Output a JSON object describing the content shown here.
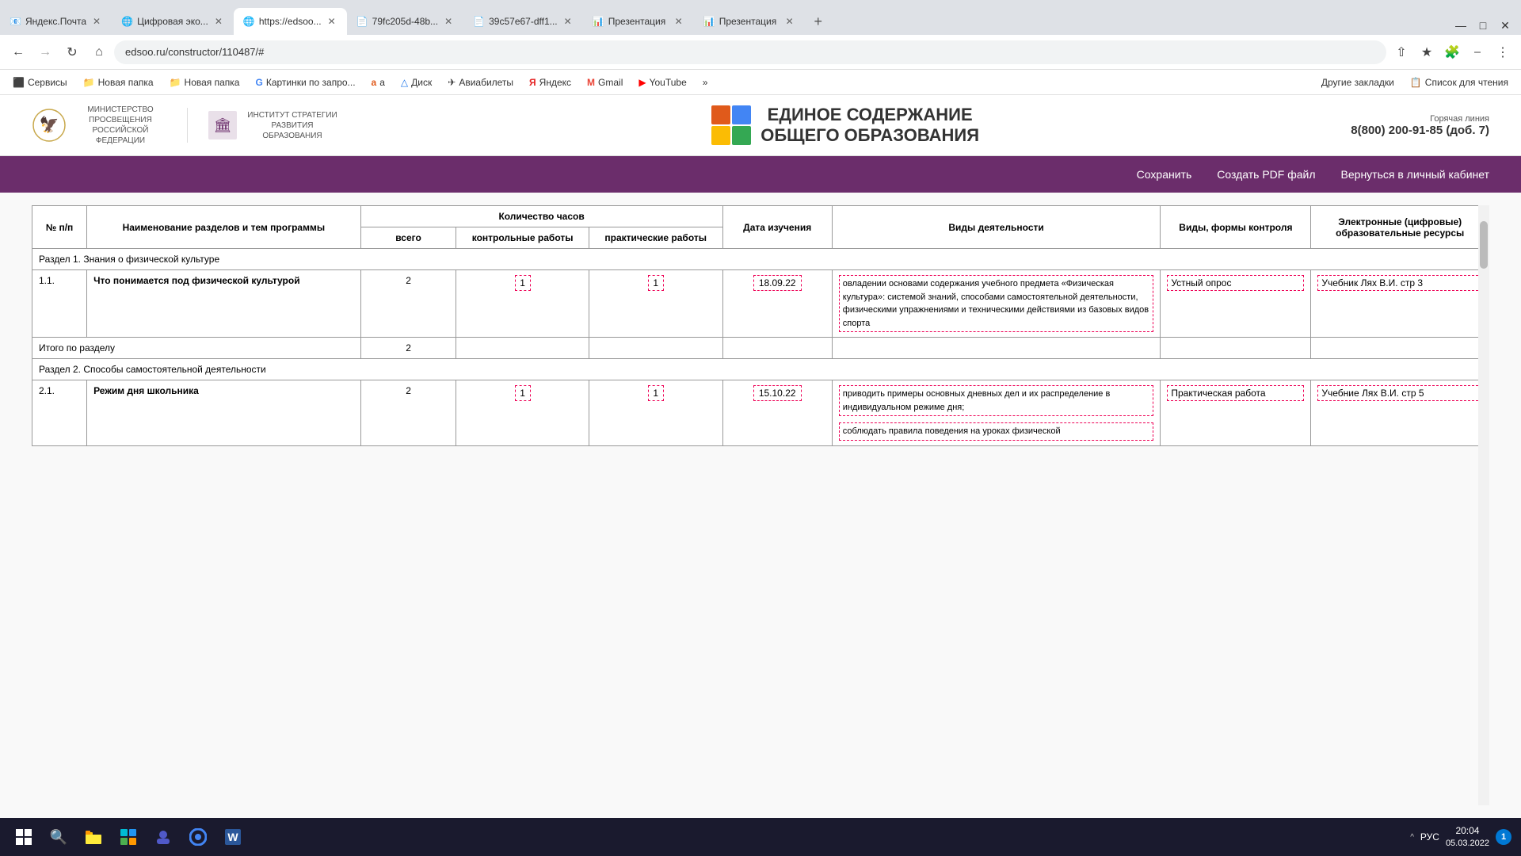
{
  "tabs": [
    {
      "id": "t1",
      "title": "Яндекс.Почта",
      "favicon": "📧",
      "active": false
    },
    {
      "id": "t2",
      "title": "Цифровая эко...",
      "favicon": "🌐",
      "active": false
    },
    {
      "id": "t3",
      "title": "https://edsoo...",
      "favicon": "🌐",
      "active": true
    },
    {
      "id": "t4",
      "title": "79fc205d-48b...",
      "favicon": "📄",
      "active": false
    },
    {
      "id": "t5",
      "title": "39c57e67-dff1...",
      "favicon": "📄",
      "active": false
    },
    {
      "id": "t6",
      "title": "Презентация",
      "favicon": "📊",
      "active": false
    },
    {
      "id": "t7",
      "title": "Презентация",
      "favicon": "📊",
      "active": false
    }
  ],
  "url_bar": "edsoo.ru/constructor/110487/#",
  "bookmarks": [
    {
      "label": "Сервисы",
      "icon": "⬛"
    },
    {
      "label": "Новая папка",
      "icon": "📁"
    },
    {
      "label": "Новая папка",
      "icon": "📁"
    },
    {
      "label": "Картинки по запро...",
      "icon": "G"
    },
    {
      "label": "a",
      "icon": "🅰"
    },
    {
      "label": "Диск",
      "icon": "△"
    },
    {
      "label": "Авиабилеты",
      "icon": "✈"
    },
    {
      "label": "Яндекс",
      "icon": "Я"
    },
    {
      "label": "Gmail",
      "icon": "M"
    },
    {
      "label": "YouTube",
      "icon": "▶"
    }
  ],
  "bookmarks_more": "»",
  "other_bookmarks": "Другие закладки",
  "reading_list": "Список для чтения",
  "header": {
    "ministry_line1": "МИНИСТЕРСТВО ПРОСВЕЩЕНИЯ",
    "ministry_line2": "РОССИЙСКОЙ ФЕДЕРАЦИИ",
    "institute_line1": "ИНСТИТУТ СТРАТЕГИИ",
    "institute_line2": "РАЗВИТИЯ ОБРАЗОВАНИЯ",
    "site_title_line1": "ЕДИНОЕ СОДЕРЖАНИЕ",
    "site_title_line2": "ОБЩЕГО ОБРАЗОВАНИЯ",
    "hotline_label": "Горячая линия",
    "hotline_number": "8(800) 200-91-85",
    "hotline_ext": "(доб. 7)"
  },
  "purple_nav": {
    "items": [
      "Сохранить",
      "Создать PDF файл",
      "Вернуться в личный кабинет"
    ]
  },
  "table": {
    "headers": {
      "num": "№ п/п",
      "name": "Наименование разделов и тем программы",
      "hours_label": "Количество часов",
      "hours_all": "всего",
      "hours_control": "контрольные работы",
      "hours_practical": "практические работы",
      "date": "Дата изучения",
      "activity": "Виды деятельности",
      "control": "Виды, формы контроля",
      "resources": "Электронные (цифровые) образовательные ресурсы"
    },
    "section1_label": "Раздел 1. Знания о физической культуре",
    "rows": [
      {
        "num": "1.1.",
        "name": "Что понимается под физической культурой",
        "hours_all": "2",
        "hours_control": "1",
        "hours_practical": "1",
        "date": "18.09.22",
        "activity": "овладении основами содержания учебного предмета «Физическая культура»: системой знаний, способами самостоятельной деятельности, физическими упражнениями и техническими действиями из базовых видов спорта",
        "control": "Устный опрос",
        "resources": "Учебник Лях В.И. стр 3"
      }
    ],
    "section1_total_label": "Итого по разделу",
    "section1_total_hours": "2",
    "section2_label": "Раздел 2. Способы самостоятельной деятельности",
    "rows2": [
      {
        "num": "2.1.",
        "name": "Режим дня школьника",
        "hours_all": "2",
        "hours_control": "1",
        "hours_practical": "1",
        "date": "15.10.22",
        "activity1": "приводить примеры основных дневных дел и их распределение в индивидуальном режиме дня;",
        "activity2": "соблюдать правила поведения на уроках физической",
        "control": "Практическая работа",
        "resources": "Учебние Лях В.И. стр 5"
      }
    ]
  },
  "taskbar": {
    "time": "20:04",
    "date": "05.03.2022",
    "lang": "РУС",
    "notification_count": "1"
  }
}
